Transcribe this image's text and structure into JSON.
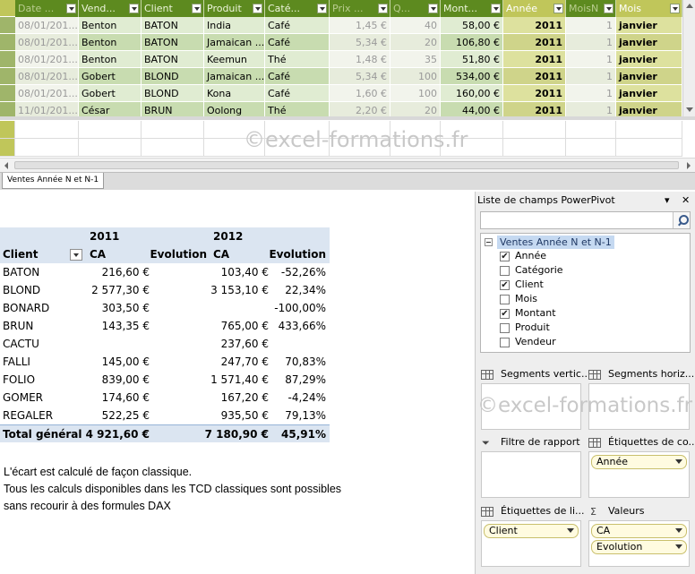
{
  "grid": {
    "columns": [
      {
        "label": "Date ...",
        "dim": true
      },
      {
        "label": "Vend...",
        "dim": false
      },
      {
        "label": "Client",
        "dim": false
      },
      {
        "label": "Produit",
        "dim": false
      },
      {
        "label": "Caté...",
        "dim": false
      },
      {
        "label": "Prix ...",
        "dim": true
      },
      {
        "label": "Q...",
        "dim": true
      },
      {
        "label": "Mont...",
        "dim": false
      },
      {
        "label": "Année",
        "dim": false
      },
      {
        "label": "MoisN",
        "dim": true
      },
      {
        "label": "Mois",
        "dim": false
      }
    ],
    "rows": [
      [
        "08/01/201...",
        "Benton",
        "BATON",
        "India",
        "Café",
        "1,45 €",
        "40",
        "58,00 €",
        "2011",
        "1",
        "janvier"
      ],
      [
        "08/01/201...",
        "Benton",
        "BATON",
        "Jamaican ...",
        "Café",
        "5,34 €",
        "20",
        "106,80 €",
        "2011",
        "1",
        "janvier"
      ],
      [
        "08/01/201...",
        "Benton",
        "BATON",
        "Keemun",
        "Thé",
        "1,48 €",
        "35",
        "51,80 €",
        "2011",
        "1",
        "janvier"
      ],
      [
        "08/01/201...",
        "Gobert",
        "BLOND",
        "Jamaican ...",
        "Café",
        "5,34 €",
        "100",
        "534,00 €",
        "2011",
        "1",
        "janvier"
      ],
      [
        "08/01/201...",
        "Gobert",
        "BLOND",
        "Kona",
        "Café",
        "1,60 €",
        "100",
        "160,00 €",
        "2011",
        "1",
        "janvier"
      ],
      [
        "11/01/201...",
        "César",
        "BRUN",
        "Oolong",
        "Thé",
        "2,20 €",
        "20",
        "44,00 €",
        "2011",
        "1",
        "janvier"
      ]
    ],
    "watermark": "©excel-formations.fr",
    "sheet_tab": "Ventes Année N et N-1"
  },
  "pivot": {
    "year1": "2011",
    "year2": "2012",
    "client_header": "Client",
    "ca_label": "CA",
    "evolution_label": "Evolution",
    "rows": [
      {
        "client": "BATON",
        "ca2011": "216,60 €",
        "ca2012": "103,40 €",
        "evolution": "-52,26%"
      },
      {
        "client": "BLOND",
        "ca2011": "2 577,30 €",
        "ca2012": "3 153,10 €",
        "evolution": "22,34%"
      },
      {
        "client": "BONARD",
        "ca2011": "303,50 €",
        "ca2012": "",
        "evolution": "-100,00%"
      },
      {
        "client": "BRUN",
        "ca2011": "143,35 €",
        "ca2012": "765,00 €",
        "evolution": "433,66%"
      },
      {
        "client": "CACTU",
        "ca2011": "",
        "ca2012": "237,60 €",
        "evolution": ""
      },
      {
        "client": "FALLI",
        "ca2011": "145,00 €",
        "ca2012": "247,70 €",
        "evolution": "70,83%"
      },
      {
        "client": "FOLIO",
        "ca2011": "839,00 €",
        "ca2012": "1 571,40 €",
        "evolution": "87,29%"
      },
      {
        "client": "GOMER",
        "ca2011": "174,60 €",
        "ca2012": "167,20 €",
        "evolution": "-4,24%"
      },
      {
        "client": "REGALER",
        "ca2011": "522,25 €",
        "ca2012": "935,50 €",
        "evolution": "79,13%"
      }
    ],
    "total": {
      "label": "Total général",
      "ca2011": "4 921,60 €",
      "ca2012": "7 180,90 €",
      "evolution": "45,91%"
    }
  },
  "notes": {
    "line1": "L'écart est calculé de façon classique.",
    "line2": "Tous les calculs disponibles dans les TCD classiques sont possibles",
    "line3": "sans recourir à des formules DAX"
  },
  "fieldlist": {
    "title": "Liste de champs PowerPivot",
    "search_placeholder": "",
    "table_name": "Ventes Année N et N-1",
    "fields": [
      {
        "name": "Année",
        "checked": true
      },
      {
        "name": "Catégorie",
        "checked": false
      },
      {
        "name": "Client",
        "checked": true
      },
      {
        "name": "Mois",
        "checked": false
      },
      {
        "name": "Montant",
        "checked": true
      },
      {
        "name": "Produit",
        "checked": false
      },
      {
        "name": "Vendeur",
        "checked": false
      }
    ],
    "zones": {
      "slicers_vertical": "Segments vertic...",
      "slicers_horizontal": "Segments horiz...",
      "report_filter": "Filtre de rapport",
      "column_labels": "Étiquettes de co...",
      "row_labels": "Étiquettes de li...",
      "values": "Valeurs"
    },
    "column_pills": [
      "Année"
    ],
    "row_pills": [
      "Client"
    ],
    "value_pills": [
      "CA",
      "Evolution"
    ],
    "watermark": "©excel-formations.fr",
    "dropdown_glyph": "▾",
    "close_glyph": "✕",
    "check_glyph": "✔"
  }
}
